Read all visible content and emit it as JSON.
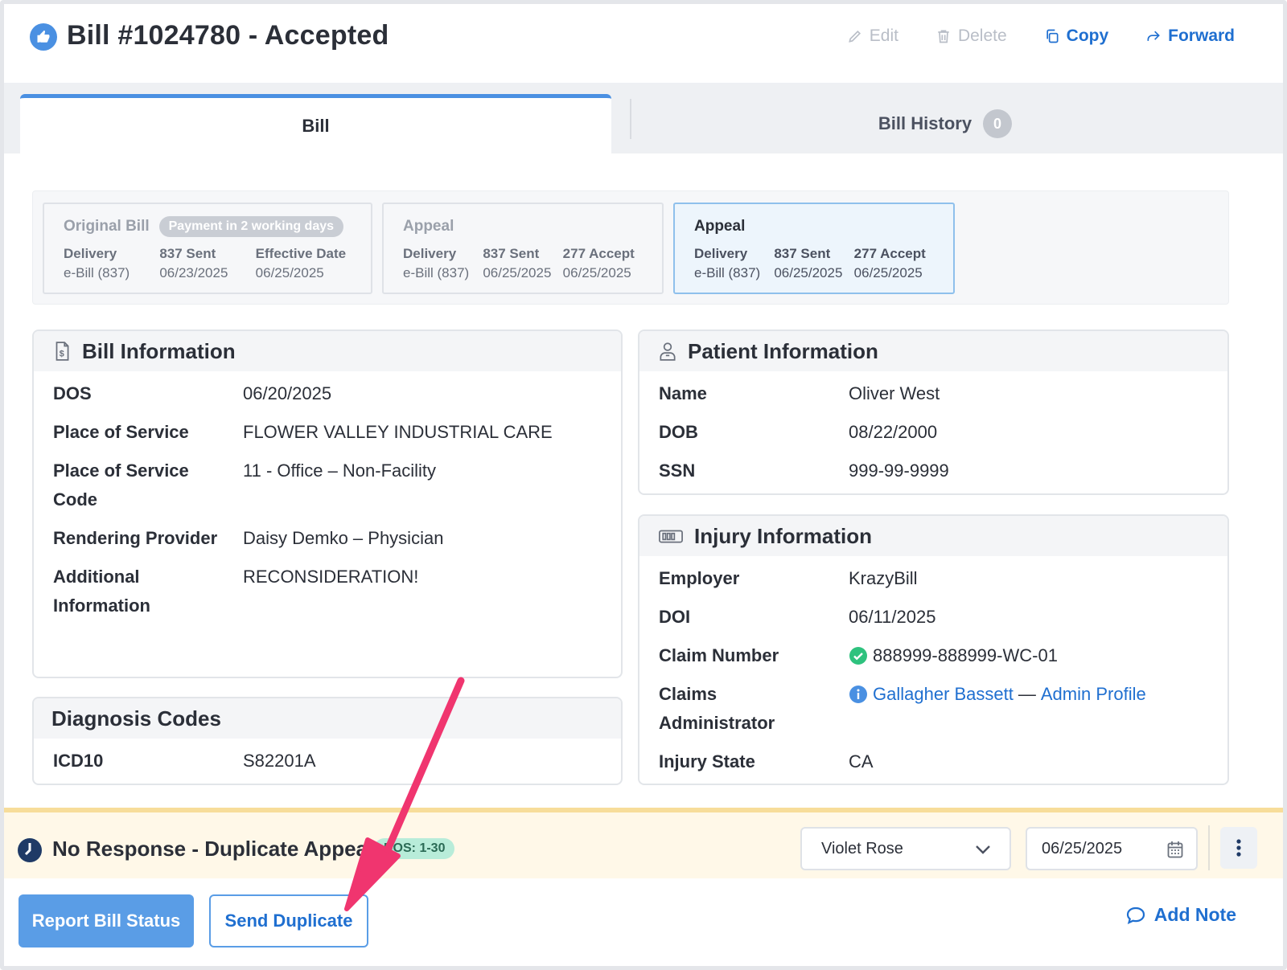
{
  "header": {
    "title": "Bill #1024780 - Accepted",
    "actions": {
      "edit": "Edit",
      "delete": "Delete",
      "copy": "Copy",
      "forward": "Forward"
    }
  },
  "tabs": {
    "bill": "Bill",
    "history": "Bill History",
    "history_count": "0"
  },
  "versions": [
    {
      "title": "Original Bill",
      "pill": "Payment in 2 working days",
      "cols": [
        {
          "label": "Delivery",
          "value": "e-Bill (837)"
        },
        {
          "label": "837 Sent",
          "value": "06/23/2025"
        },
        {
          "label": "Effective Date",
          "value": "06/25/2025"
        }
      ]
    },
    {
      "title": "Appeal",
      "cols": [
        {
          "label": "Delivery",
          "value": "e-Bill (837)"
        },
        {
          "label": "837 Sent",
          "value": "06/25/2025"
        },
        {
          "label": "277 Accept",
          "value": "06/25/2025"
        }
      ]
    },
    {
      "title": "Appeal",
      "cols": [
        {
          "label": "Delivery",
          "value": "e-Bill (837)"
        },
        {
          "label": "837 Sent",
          "value": "06/25/2025"
        },
        {
          "label": "277 Accept",
          "value": "06/25/2025"
        }
      ]
    }
  ],
  "bill_info": {
    "title": "Bill Information",
    "rows": [
      {
        "k": "DOS",
        "v": "06/20/2025"
      },
      {
        "k": "Place of Service",
        "v": "FLOWER VALLEY INDUSTRIAL CARE"
      },
      {
        "k": "Place of Service Code",
        "k1": "Place of Service",
        "k2": "Code",
        "v": "11 - Office – Non-Facility"
      },
      {
        "k": "Rendering Provider",
        "v": "Daisy Demko – Physician"
      },
      {
        "k": "Additional Information",
        "k1": "Additional",
        "k2": "Information",
        "v": "RECONSIDERATION!"
      }
    ]
  },
  "diagnosis": {
    "title": "Diagnosis Codes",
    "rows": [
      {
        "k": "ICD10",
        "v": "S82201A"
      }
    ]
  },
  "patient_info": {
    "title": "Patient Information",
    "rows": [
      {
        "k": "Name",
        "v": "Oliver West"
      },
      {
        "k": "DOB",
        "v": "08/22/2000"
      },
      {
        "k": "SSN",
        "v": "999-99-9999"
      }
    ]
  },
  "injury_info": {
    "title": "Injury Information",
    "rows": [
      {
        "k": "Employer",
        "v": "KrazyBill"
      },
      {
        "k": "DOI",
        "v": "06/11/2025"
      },
      {
        "k": "Claim Number",
        "v": "888999-888999-WC-01"
      },
      {
        "k": "Claims Administrator",
        "k1": "Claims",
        "k2": "Administrator",
        "v1": "Gallagher Bassett",
        "sep": "—",
        "v2": "Admin Profile"
      },
      {
        "k": "Injury State",
        "v": "CA"
      }
    ]
  },
  "status_bar": {
    "text": "No Response - Duplicate Appeal",
    "dos_pill": "DOS: 1-30",
    "assignee": "Violet Rose",
    "date": "06/25/2025"
  },
  "footer": {
    "report_button": "Report Bill Status",
    "send_duplicate_button": "Send Duplicate",
    "add_note": "Add Note"
  },
  "colors": {
    "accent": "#4a90e2",
    "link": "#1f6fd0",
    "status_bar_bg": "#fff8e8",
    "annotation_arrow": "#f0356f",
    "success": "#2ec27e"
  },
  "icons": [
    "thumbs-up-icon",
    "pencil-icon",
    "trash-icon",
    "copy-icon",
    "forward-icon",
    "bill-document-icon",
    "patient-icon",
    "id-card-icon",
    "check-circle-icon",
    "info-icon",
    "clock-icon",
    "chevron-down-icon",
    "calendar-icon",
    "kebab-icon",
    "chat-bubble-icon",
    "annotation-arrow"
  ]
}
